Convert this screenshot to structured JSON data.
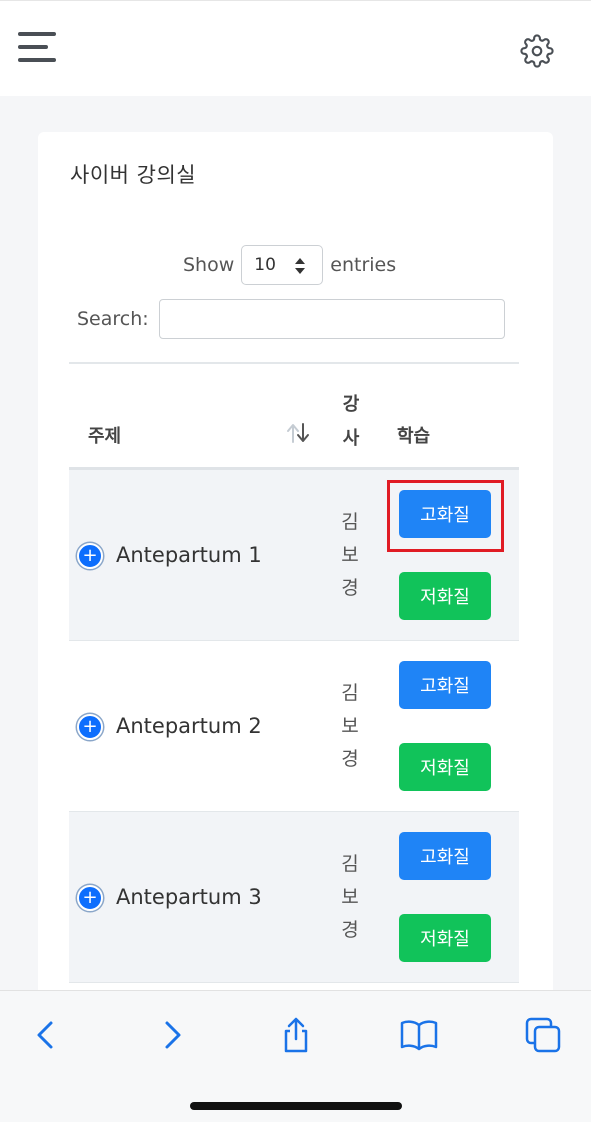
{
  "header": {
    "menu_icon": "hamburger-menu-icon",
    "settings_icon": "gear-icon"
  },
  "card": {
    "title": "사이버 강의실"
  },
  "length_control": {
    "show_label": "Show",
    "selected_value": "10",
    "entries_label": "entries"
  },
  "search": {
    "label": "Search:",
    "value": "",
    "placeholder": ""
  },
  "table": {
    "headers": {
      "topic": "주제",
      "instructor_line1": "강",
      "instructor_line2": "사",
      "study": "학습"
    },
    "rows": [
      {
        "topic": "Antepartum 1",
        "instructor": [
          "김",
          "보",
          "경"
        ],
        "hq_label": "고화질",
        "lq_label": "저화질"
      },
      {
        "topic": "Antepartum 2",
        "instructor": [
          "김",
          "보",
          "경"
        ],
        "hq_label": "고화질",
        "lq_label": "저화질"
      },
      {
        "topic": "Antepartum 3",
        "instructor": [
          "김",
          "보",
          "경"
        ],
        "hq_label": "고화질",
        "lq_label": "저화질"
      }
    ]
  },
  "colors": {
    "hq_button": "#1f84f6",
    "lq_button": "#11c35a",
    "highlight": "#e01b24",
    "safari_blue": "#1a73e8"
  },
  "browser_toolbar": {
    "icons": [
      "back-icon",
      "forward-icon",
      "share-icon",
      "bookmarks-icon",
      "tabs-icon"
    ]
  }
}
